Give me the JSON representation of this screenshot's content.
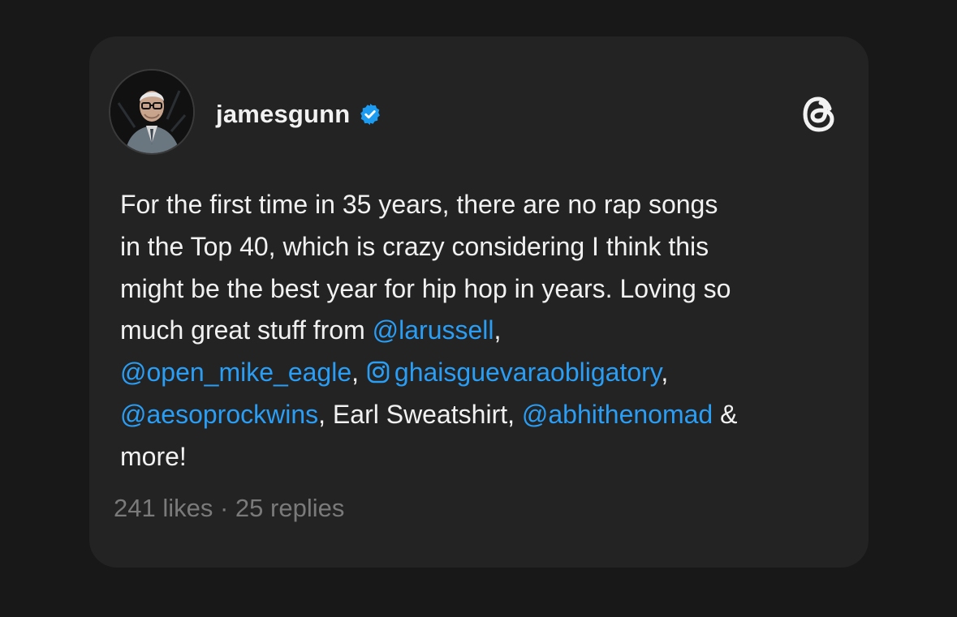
{
  "post": {
    "username": "jamesgunn",
    "verified_icon": "verified-badge-icon",
    "platform_icon": "threads-logo-icon",
    "lines": {
      "l1": "For the first time in 35 years, there are no rap songs",
      "l2": "in the Top 40, which is crazy considering I think this",
      "l3": "might be the best year for hip hop in years. Loving so",
      "l4_text": "much great stuff from ",
      "l4_mention": "@larussell",
      "l4_end": ",",
      "l5_mention": "@open_mike_eagle",
      "l5_sep": ", ",
      "l5_ig_mention": "ghaisguevaraobligatory",
      "l5_end": ",",
      "l6_mention1": "@aesoprockwins",
      "l6_text": ", Earl Sweatshirt, ",
      "l6_mention2": "@abhithenomad",
      "l6_end": " &",
      "l7": "more!"
    },
    "stats": {
      "likes": "241 likes",
      "separator": " · ",
      "replies": "25 replies"
    }
  },
  "colors": {
    "page_background": "#181818",
    "card_background": "#232323",
    "text": "#f1f1f1",
    "mention": "#2a9df4",
    "stats": "#7a7a7a",
    "verified": "#1d9bf0"
  }
}
